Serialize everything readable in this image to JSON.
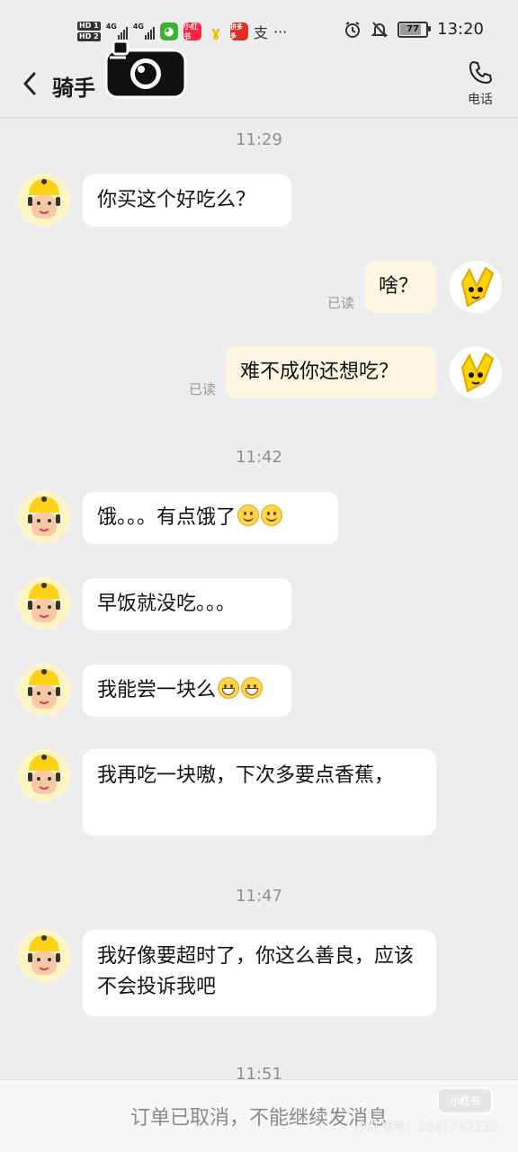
{
  "status_bar": {
    "hd1": "HD 1",
    "hd2": "HD 2",
    "net1": "4G",
    "net2": "4G",
    "app_icon_1": "小红书",
    "app_icon_3": "拼多多",
    "app_icon_4": "支",
    "more": "···",
    "battery": "77",
    "clock": "13:20"
  },
  "header": {
    "title": "骑手",
    "phone_label": "电话"
  },
  "chat": {
    "times": [
      "11:29",
      "11:42",
      "11:47",
      "11:51"
    ],
    "read_label": "已读",
    "messages": [
      {
        "side": "left",
        "text": "你买这个好吃么？"
      },
      {
        "side": "right",
        "text": "啥？"
      },
      {
        "side": "right",
        "text": "难不成你还想吃？"
      },
      {
        "side": "left",
        "text": "饿。。。有点饿了"
      },
      {
        "side": "left",
        "text": "早饭就没吃。。。"
      },
      {
        "side": "left",
        "text": "我能尝一块么"
      },
      {
        "side": "left",
        "text": "我再吃一块嗷，下次多要点香蕉，"
      },
      {
        "side": "left",
        "text": "我好像要超时了，你这么善良，应该不会投诉我吧"
      }
    ]
  },
  "footer": {
    "notice": "订单已取消，不能继续发消息"
  },
  "watermark": {
    "logo": "小红书",
    "id_text": "小红书号：9641742220"
  },
  "icons": [
    "back-arrow-icon",
    "camera-sticker-icon",
    "phone-icon",
    "alarm-icon",
    "mute-bell-icon",
    "smile-emoji-icon",
    "grin-emoji-icon"
  ]
}
